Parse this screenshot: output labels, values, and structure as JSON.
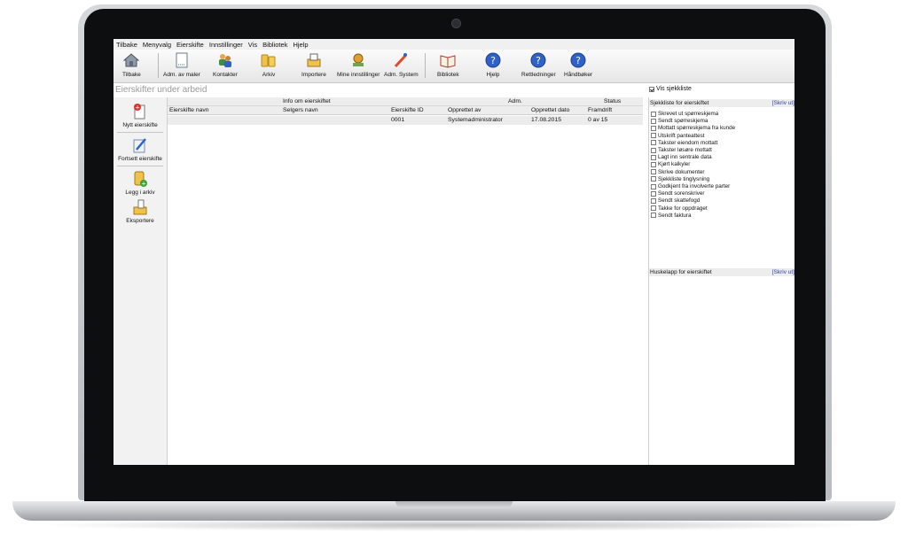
{
  "menu": [
    "Tilbake",
    "Menyvalg",
    "Eierskifte",
    "Innstillinger",
    "Vis",
    "Bibliotek",
    "Hjelp"
  ],
  "toolbar": [
    {
      "label": "Tilbake",
      "icon": "home-icon"
    },
    {
      "label": "Adm. av maler",
      "icon": "document-template-icon"
    },
    {
      "label": "Kontakter",
      "icon": "contacts-icon"
    },
    {
      "label": "Arkiv",
      "icon": "archive-icon"
    },
    {
      "label": "Importere",
      "icon": "import-icon"
    },
    {
      "label": "Mine innstillinger",
      "icon": "user-settings-icon"
    },
    {
      "label": "Adm. System",
      "icon": "admin-wand-icon"
    },
    {
      "label": "Bibliotek",
      "icon": "library-book-icon"
    },
    {
      "label": "Hjelp",
      "icon": "help-icon"
    },
    {
      "label": "Rettledninger",
      "icon": "help-icon"
    },
    {
      "label": "Håndbøker",
      "icon": "help-icon"
    }
  ],
  "page_title": "Eierskifter under arbeid",
  "vis_sjekkliste": {
    "label": "Vis sjekkliste",
    "checked": true
  },
  "left_actions": [
    {
      "label": "Nytt eierskifte",
      "icon": "new-document-icon"
    },
    {
      "label": "Fortsett eierskifte",
      "icon": "edit-pencil-icon"
    },
    {
      "label": "Legg i arkiv",
      "icon": "archive-add-icon"
    },
    {
      "label": "Eksportere",
      "icon": "export-icon"
    }
  ],
  "grid": {
    "groups": [
      "Info om eierskiftet",
      "Adm.",
      "Status"
    ],
    "columns": [
      "Eierskifte navn",
      "Selgers navn",
      "Eierskifte ID",
      "Opprettet av",
      "Opprettet dato",
      "Framdrift"
    ],
    "rows": [
      [
        "",
        "",
        "0001",
        "Systemadministrator",
        "17.08.2015",
        "0 av 15"
      ]
    ]
  },
  "checklist": {
    "title": "Sjekkliste for eierskiftet",
    "print": "[Skriv ut]",
    "items": [
      "Skrevet ut spørreskjema",
      "Sendt spørreskjema",
      "Mottatt spørreskjema fra kunde",
      "Utskrift panteattest",
      "Takster eiendom mottatt",
      "Takster løsøre mottatt",
      "Lagt inn sentrale data",
      "Kjørt kalkyler",
      "Skrive dokumenter",
      "Sjekkliste tinglysning",
      "Godkjent fra involverte parter",
      "Sendt sorenskriver",
      "Sendt skattefogd",
      "Takke for oppdraget",
      "Sendt faktura"
    ]
  },
  "notes": {
    "title": "Huskelapp for eierskiftet",
    "print": "[Skriv ut]"
  },
  "colors": {
    "link": "#2b3aa8",
    "help_blue": "#2f62c9",
    "title_gray": "#9a9a9a"
  }
}
